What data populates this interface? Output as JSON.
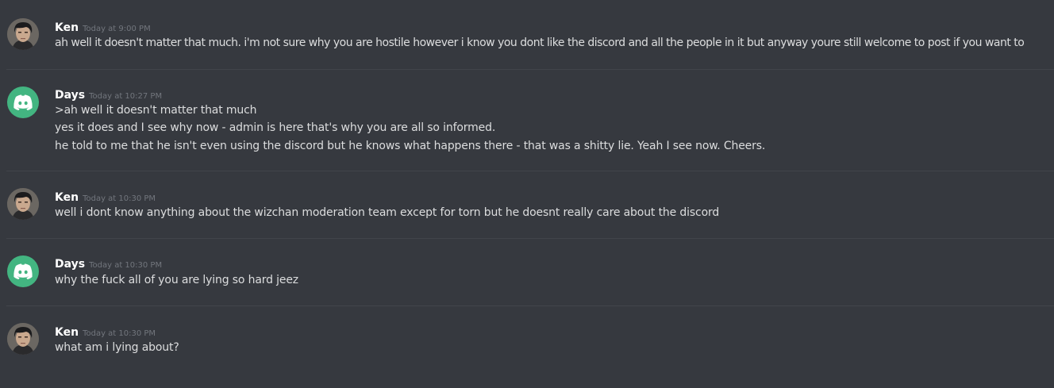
{
  "messages": [
    {
      "author": "Ken",
      "avatar": "ken-avatar",
      "timestamp": "Today at 9:00 PM",
      "lines": [
        "ah well it doesn't matter that much. i'm not sure why you are hostile however i know you dont like the discord and all the people in it but anyway youre still welcome to post if you want to"
      ]
    },
    {
      "author": "Days",
      "avatar": "discord-default-avatar",
      "timestamp": "Today at 10:27 PM",
      "lines": [
        ">ah well it doesn't matter that much",
        "yes it does and I see why now - admin is here that's why you are all so informed.",
        "he told to me that he isn't even using the discord but he knows what happens there - that was a shitty lie. Yeah I see now. Cheers."
      ]
    },
    {
      "author": "Ken",
      "avatar": "ken-avatar",
      "timestamp": "Today at 10:30 PM",
      "lines": [
        "well i dont know anything about the wizchan moderation team except for torn but he doesnt really care about the discord"
      ]
    },
    {
      "author": "Days",
      "avatar": "discord-default-avatar",
      "timestamp": "Today at 10:30 PM",
      "lines": [
        "why the fuck all of you are lying so hard jeez"
      ]
    },
    {
      "author": "Ken",
      "avatar": "ken-avatar",
      "timestamp": "Today at 10:30 PM",
      "lines": [
        "what am i lying about?"
      ]
    }
  ],
  "colors": {
    "background": "#36393f",
    "divider": "#42454b",
    "username": "#ffffff",
    "timestamp": "#72767d",
    "message_text": "#dcddde",
    "discord_avatar": "#43b581"
  }
}
